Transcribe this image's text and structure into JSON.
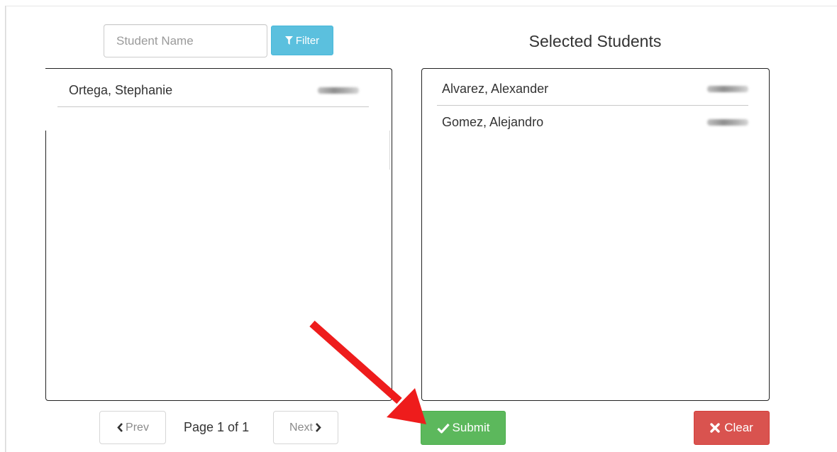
{
  "search": {
    "placeholder": "Student Name"
  },
  "filter_button": {
    "label": "Filter",
    "icon": "filter-icon"
  },
  "available_students": [
    {
      "name": "Ortega, Stephanie"
    }
  ],
  "selected_panel": {
    "title": "Selected Students",
    "students": [
      {
        "name": "Alvarez, Alexander"
      },
      {
        "name": "Gomez, Alejandro"
      }
    ]
  },
  "pagination": {
    "prev_label": "Prev",
    "page_label": "Page 1 of 1",
    "next_label": "Next"
  },
  "actions": {
    "submit_label": "Submit",
    "submit_icon": "check-icon",
    "clear_label": "Clear",
    "clear_icon": "times-icon"
  },
  "colors": {
    "filter": "#5bc0de",
    "submit": "#5cb85c",
    "clear": "#d9534f",
    "annotation_arrow": "#ee1c1c"
  }
}
